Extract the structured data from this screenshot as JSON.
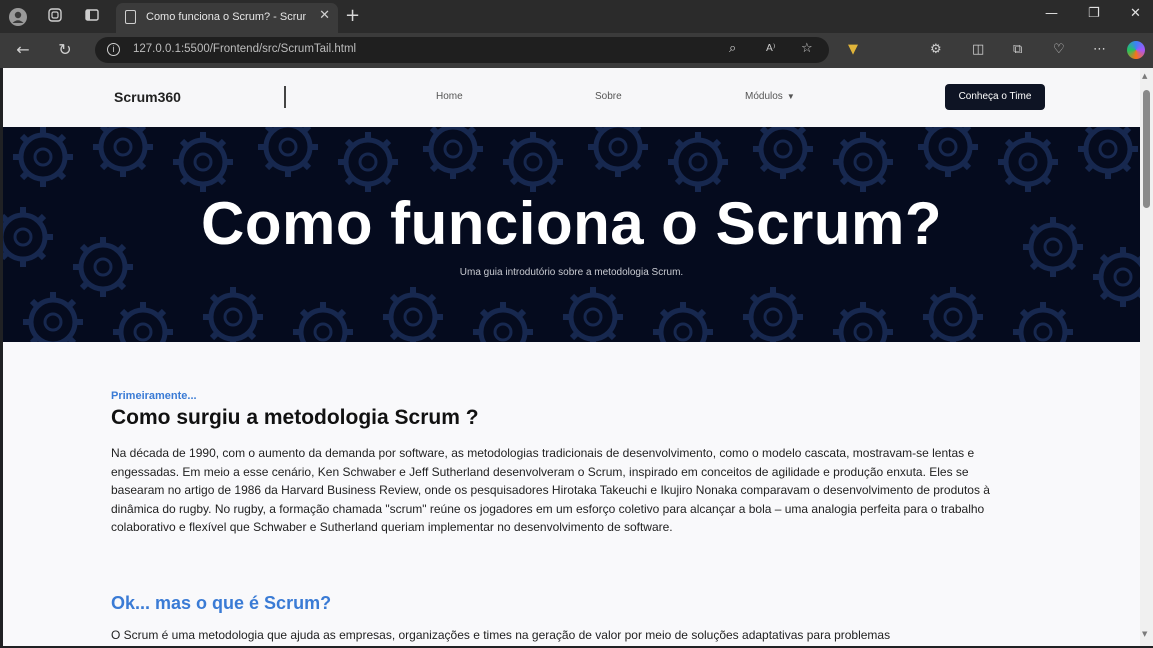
{
  "browser": {
    "tab_title": "Como funciona o Scrum? - Scrum",
    "tab_close": "✕",
    "new_tab": "+",
    "url": "127.0.0.1:5500/Frontend/src/ScrumTail.html",
    "window_controls": {
      "minimize": "—",
      "restore": "❐",
      "close": "✕"
    },
    "icons": [
      "profile-icon",
      "workspaces-icon",
      "tab-actions-icon",
      "back-icon",
      "refresh-icon",
      "info-icon",
      "zoom-icon",
      "read-aloud-icon",
      "favorite-icon",
      "extension-icon",
      "extensions-icon",
      "split-screen-icon",
      "collections-icon",
      "performance-icon",
      "more-icon",
      "copilot-icon"
    ]
  },
  "site_nav": {
    "brand": "Scrum360",
    "links": [
      "Home",
      "Sobre",
      "Módulos"
    ],
    "cta": "Conheça o Time"
  },
  "hero": {
    "title": "Como funciona o Scrum?",
    "subtitle": "Uma guia introdutório sobre a metodologia Scrum."
  },
  "section1": {
    "kicker": "Primeiramente...",
    "heading": "Como surgiu a metodologia Scrum ?",
    "body": "Na década de 1990, com o aumento da demanda por software, as metodologias tradicionais de desenvolvimento, como o modelo cascata, mostravam-se lentas e engessadas. Em meio a esse cenário, Ken Schwaber e Jeff Sutherland desenvolveram o Scrum, inspirado em conceitos de agilidade e produção enxuta. Eles se basearam no artigo de 1986 da Harvard Business Review, onde os pesquisadores Hirotaka Takeuchi e Ikujiro Nonaka comparavam o desenvolvimento de produtos à dinâmica do rugby. No rugby, a formação chamada \"scrum\" reúne os jogadores em um esforço coletivo para alcançar a bola – uma analogia perfeita para o trabalho colaborativo e flexível que Schwaber e Sutherland queriam implementar no desenvolvimento de software."
  },
  "section2": {
    "heading": "Ok... mas o que é Scrum?",
    "body": "O Scrum é uma metodologia que ajuda as empresas, organizações e times na geração de valor por meio de soluções adaptativas para problemas"
  },
  "colors": {
    "hero_bg": "#050b1e",
    "accent": "#3a7bd5",
    "cta_bg": "#0e1424"
  }
}
